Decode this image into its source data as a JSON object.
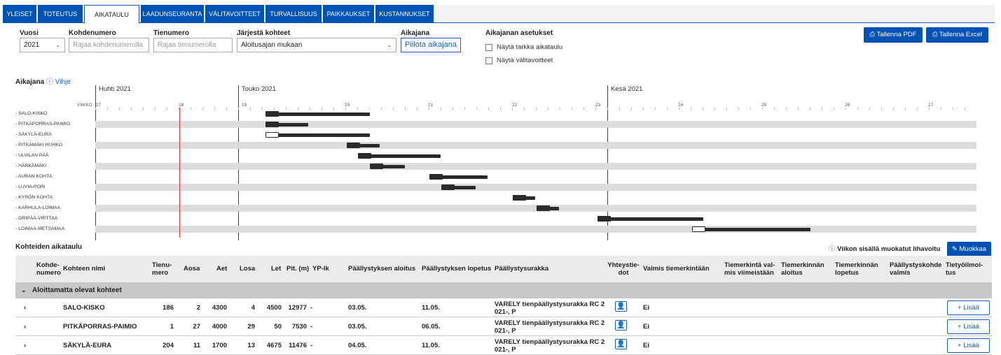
{
  "tabs": [
    {
      "label": "Yleiset"
    },
    {
      "label": "Toteutus"
    },
    {
      "label": "Aikataulu"
    },
    {
      "label": "Laadunseuranta"
    },
    {
      "label": "Välitavoitteet"
    },
    {
      "label": "Turvallisuus"
    },
    {
      "label": "Paikkaukset"
    },
    {
      "label": "Kustannukset"
    }
  ],
  "filters": {
    "vuosi_label": "Vuosi",
    "vuosi_value": "2021",
    "kohdenumero_label": "Kohdenumero",
    "kohdenumero_placeholder": "Rajaa kohdenumerolla",
    "tienumero_label": "Tienumero",
    "tienumero_placeholder": "Rajaa tienumerolla",
    "jarjesta_label": "Järjestä kohteet",
    "jarjesta_value": "Aloitusajan mukaan",
    "aikajana_label": "Aikajana",
    "aikajana_button": "Piilota aikajana",
    "asetukset_label": "Aikajanan asetukset",
    "tarkka_label": "Näytä tarkka aikataulu",
    "valitavoitteet_label": "Näytä välitavoitteet"
  },
  "buttons": {
    "pdf": "Tallenna PDF",
    "excel": "Tallenna Excel",
    "muokkaa": "Muokkaa"
  },
  "timeline": {
    "title": "Aikajana",
    "hint": "Vihje",
    "viikko_label": "VIIKKO",
    "months": [
      {
        "label": "Huhti 2021"
      },
      {
        "label": "Touko 2021"
      },
      {
        "label": "Kesä 2021"
      }
    ],
    "weeks": [
      "17",
      "18",
      "19",
      "20",
      "21",
      "22",
      "23",
      "24",
      "25",
      "26",
      "27"
    ],
    "rows": [
      {
        "label": "- SALO-KISKO",
        "start": 0.193,
        "end": 0.312,
        "outlined": false
      },
      {
        "label": "- PITKÄPORRAS-PAIMIO",
        "start": 0.193,
        "end": 0.242,
        "outlined": false
      },
      {
        "label": "- SÄKYLÄ-EURA",
        "start": 0.193,
        "end": 0.312,
        "outlined": true
      },
      {
        "label": "- PITKÄMÄKI-HUHKO",
        "start": 0.285,
        "end": 0.323,
        "outlined": false
      },
      {
        "label": "- ULVILAN PÄÄ",
        "start": 0.298,
        "end": 0.392,
        "outlined": false
      },
      {
        "label": "- HÄRKÄMÄKI",
        "start": 0.312,
        "end": 0.351,
        "outlined": false
      },
      {
        "label": "- AURAN KOHTA",
        "start": 0.379,
        "end": 0.445,
        "outlined": false
      },
      {
        "label": "- LUVIA-PORI",
        "start": 0.393,
        "end": 0.432,
        "outlined": false
      },
      {
        "label": "- KYRÖN KOHTA",
        "start": 0.474,
        "end": 0.499,
        "outlined": false
      },
      {
        "label": "- KARHULA-LOIMAA",
        "start": 0.501,
        "end": 0.526,
        "outlined": false
      },
      {
        "label": "- ORIPÄÄ-VIRTTAA",
        "start": 0.57,
        "end": 0.69,
        "outlined": false
      },
      {
        "label": "- LOIMAA-METSÄMAA",
        "start": 0.677,
        "end": 0.812,
        "outlined": true
      }
    ]
  },
  "schedule": {
    "title": "Kohteiden aikataulu",
    "notice": "Viikon sisällä muokatut lihavoitu",
    "headers": {
      "kohdenumero": "Kohde- numero",
      "nimi": "Kohteen nimi",
      "tienumero": "Tienu- mero",
      "aosa": "Aosa",
      "aet": "Aet",
      "losa": "Losa",
      "let": "Let",
      "pit": "Pit. (m)",
      "ypik": "YP-lk",
      "aloitus": "Päällystyksen aloitus",
      "lopetus": "Päällystyksen lopetus",
      "urakka": "Päällystysurakka",
      "yhteystiedot": "Yhteystie- dot",
      "valmis": "Valmis tiemerkintään",
      "viimeistaan": "Tiemerkintä val- mis viimeistään",
      "tm_aloitus": "Tiemerkinnän aloitus",
      "tm_lopetus": "Tiemerkinnän lopetus",
      "kohde_valmis": "Päällystyskohde valmis",
      "tietyo": "Tietyöilmoi- tus"
    },
    "group": "Aloittamatta olevat kohteet",
    "rows": [
      {
        "nimi": "SALO-KISKO",
        "tie": "186",
        "aosa": "2",
        "aet": "4300",
        "losa": "4",
        "let": "4500",
        "pit": "12977",
        "yp": "-",
        "aloitus": "03.05.",
        "lopetus": "11.05.",
        "urakka": "VARELY tienpäällystysurakka RC 2 021-, P",
        "valmis": "Ei",
        "lisaa": "+ Lisää"
      },
      {
        "nimi": "PITKÄPORRAS-PAIMIO",
        "tie": "1",
        "aosa": "27",
        "aet": "4000",
        "losa": "29",
        "let": "50",
        "pit": "7530",
        "yp": "-",
        "aloitus": "03.05.",
        "lopetus": "06.05.",
        "urakka": "VARELY tienpäällystysurakka RC 2 021-, P",
        "valmis": "Ei",
        "lisaa": "+ Lisää"
      },
      {
        "nimi": "SÄKYLÄ-EURA",
        "tie": "204",
        "aosa": "11",
        "aet": "1700",
        "losa": "13",
        "let": "4675",
        "pit": "11476",
        "yp": "-",
        "aloitus": "04.05.",
        "lopetus": "11.05.",
        "urakka": "VARELY tienpäällystysurakka RC 2 021-, P",
        "valmis": "Ei",
        "lisaa": "+ Lisää"
      }
    ]
  }
}
